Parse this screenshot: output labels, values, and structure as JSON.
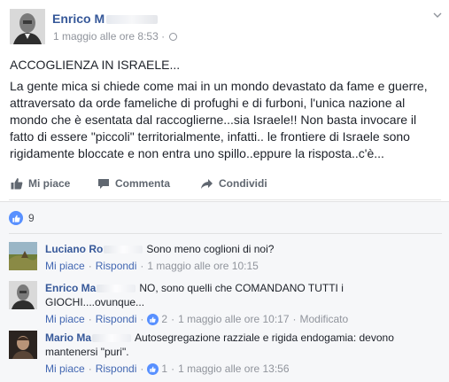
{
  "post": {
    "author": "Enrico M",
    "timestamp": "1 maggio alle ore 8:53",
    "privacy_icon": "globe-icon",
    "title": "ACCOGLIENZA IN ISRAELE...",
    "body": "La gente mica si chiede come mai in un mondo devastato da fame e guerre, attraversato da orde fameliche di profughi e di furboni, l'unica nazione al mondo che è esentata dal raccoglierne...sia Israele!! Non basta invocare il fatto di essere \"piccoli\" territorialmente, infatti.. le frontiere di Israele sono rigidamente bloccate e non entra uno spillo..eppure la risposta..c'è..."
  },
  "actions": {
    "like": "Mi piace",
    "comment": "Commenta",
    "share": "Condividi"
  },
  "reactions": {
    "count": "9"
  },
  "comments": [
    {
      "name": "Luciano Ro",
      "text": "Sono meno coglioni di noi?",
      "like_label": "Mi piace",
      "reply_label": "Rispondi",
      "time": "1 maggio alle ore 10:15"
    },
    {
      "name": "Enrico Ma",
      "text": "NO, sono quelli che COMANDANO TUTTI i GIOCHI....ovunque...",
      "like_label": "Mi piace",
      "reply_label": "Rispondi",
      "likes": "2",
      "time": "1 maggio alle ore 10:17",
      "edited": "Modificato"
    },
    {
      "name": "Mario Ma",
      "text": "Autosegregazione razziale e rigida endogamia: devono mantenersi \"puri\".",
      "like_label": "Mi piace",
      "reply_label": "Rispondi",
      "likes": "1",
      "time": "1 maggio alle ore 13:56"
    }
  ],
  "colors": {
    "link": "#365899",
    "meta": "#90949c",
    "accent": "#5890ff",
    "comments_bg": "#f6f7f9"
  }
}
